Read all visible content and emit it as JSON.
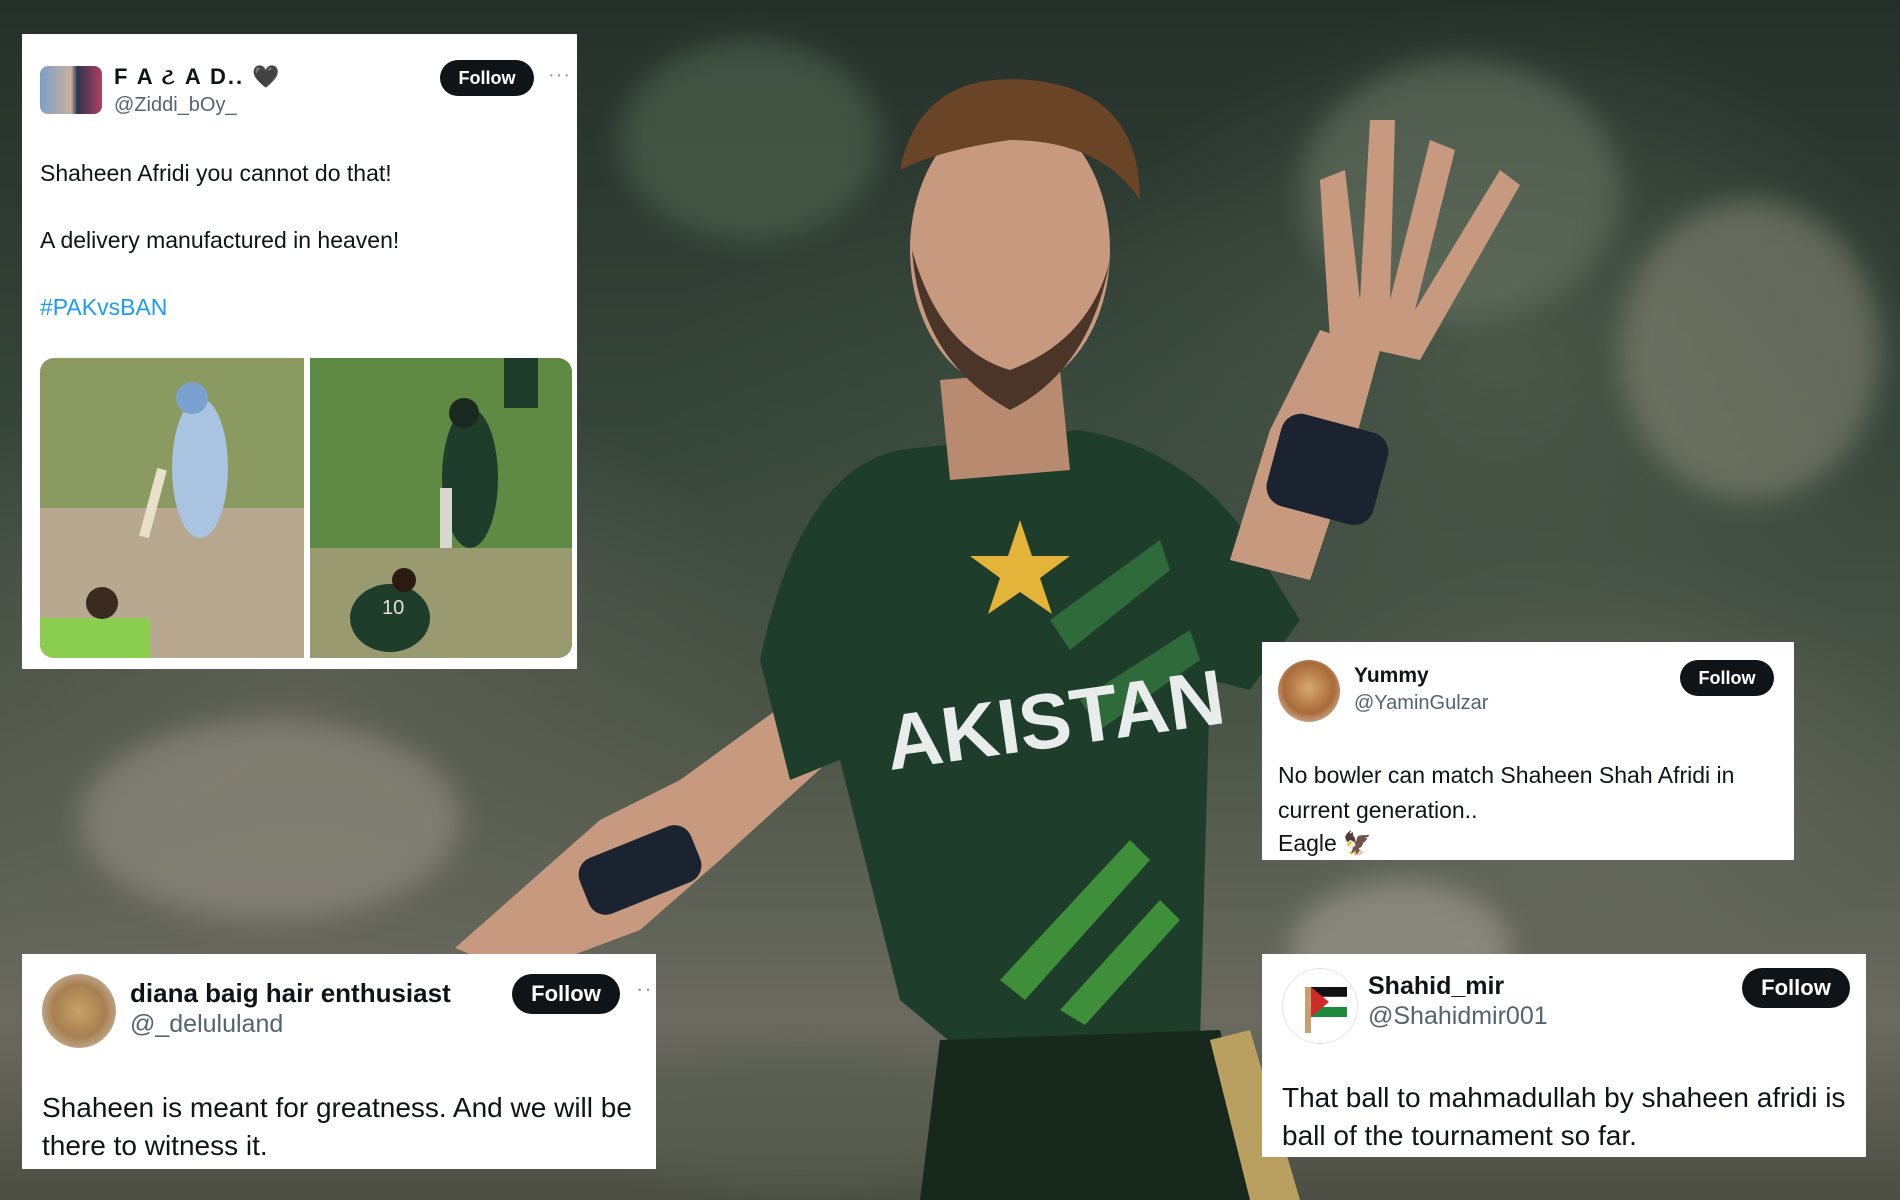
{
  "tweets": {
    "fazad": {
      "name": "F A ટ A D..",
      "heart": "🖤",
      "handle": "@Ziddi_bOy_",
      "follow": "Follow",
      "more": "···",
      "line1": "Shaheen Afridi you cannot do that!",
      "line2": "A delivery manufactured in heaven!",
      "hashtag": "#PAKvsBAN"
    },
    "yummy": {
      "name": "Yummy",
      "handle": "@YaminGulzar",
      "follow": "Follow",
      "line1": "No bowler can match Shaheen Shah Afridi in",
      "line2": "current generation..",
      "line3": "Eagle 🦅"
    },
    "diana": {
      "name": "diana baig hair enthusiast",
      "handle": "@_delululand",
      "follow": "Follow",
      "more": "··",
      "line1": "Shaheen is meant for greatness. And we will be",
      "line2": "there to witness it."
    },
    "shahid": {
      "name": "Shahid_mir",
      "handle": "@Shahidmir001",
      "follow": "Follow",
      "line1": "That ball to mahmadullah by shaheen afridi is",
      "line2": "ball of the tournament so far."
    }
  },
  "jersey": {
    "text": "AKISTAN",
    "number": "10"
  },
  "colors": {
    "jersey_green": "#1f3d2b",
    "stripe_green": "#3f8f3a",
    "star_gold": "#e4b43a",
    "link_blue": "#1d9bf0",
    "button_black": "#0f1419"
  }
}
